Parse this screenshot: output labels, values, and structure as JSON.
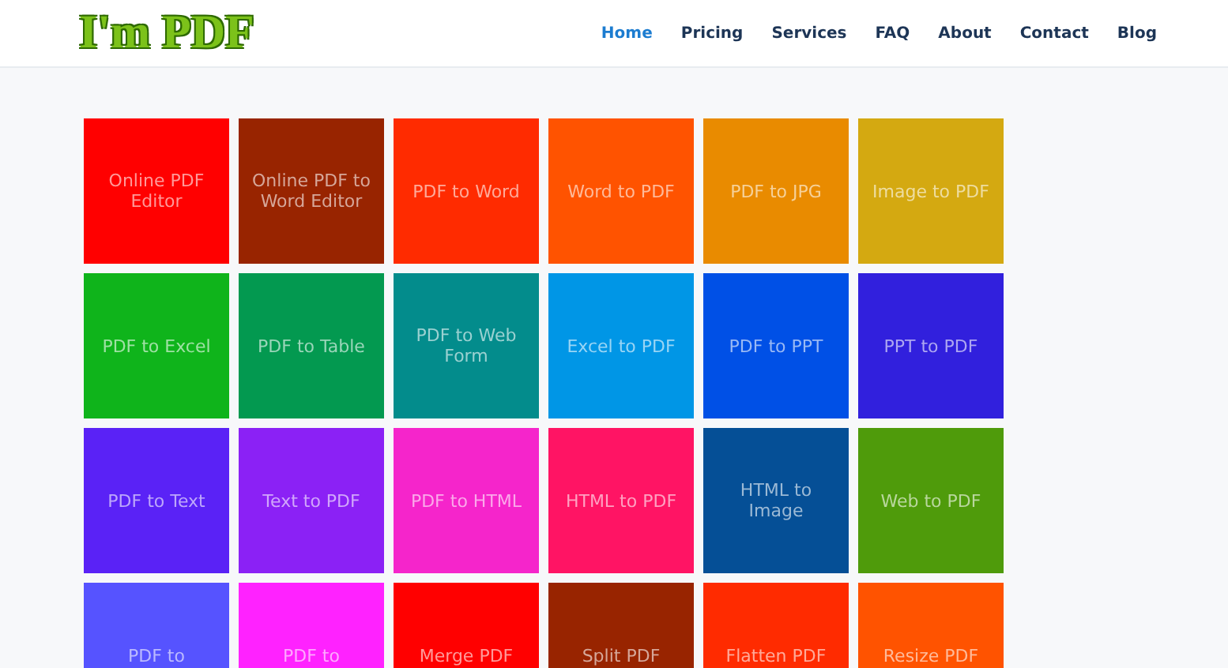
{
  "logo": "I'm PDF",
  "nav": [
    {
      "label": "Home",
      "selected": true
    },
    {
      "label": "Pricing",
      "selected": false
    },
    {
      "label": "Services",
      "selected": false
    },
    {
      "label": "FAQ",
      "selected": false
    },
    {
      "label": "About",
      "selected": false
    },
    {
      "label": "Contact",
      "selected": false
    },
    {
      "label": "Blog",
      "selected": false
    }
  ],
  "tools": [
    {
      "label": "Online PDF Editor",
      "color": "#ff0000"
    },
    {
      "label": "Online PDF to Word Editor",
      "color": "#982400"
    },
    {
      "label": "PDF to Word",
      "color": "#ff2b00"
    },
    {
      "label": "Word to PDF",
      "color": "#ff5300"
    },
    {
      "label": "PDF to JPG",
      "color": "#e98b00"
    },
    {
      "label": "Image to PDF",
      "color": "#d4a911"
    },
    {
      "label": "PDF to Excel",
      "color": "#0fb41b"
    },
    {
      "label": "PDF to Table",
      "color": "#039950"
    },
    {
      "label": "PDF to Web Form",
      "color": "#038c8c"
    },
    {
      "label": "Excel to PDF",
      "color": "#0096e6"
    },
    {
      "label": "PDF to PPT",
      "color": "#0050e6"
    },
    {
      "label": "PPT to PDF",
      "color": "#3120dd"
    },
    {
      "label": "PDF to Text",
      "color": "#5a22f6"
    },
    {
      "label": "Text to PDF",
      "color": "#8b21f5"
    },
    {
      "label": "PDF to HTML",
      "color": "#f525cb"
    },
    {
      "label": "HTML to PDF",
      "color": "#ff1464"
    },
    {
      "label": "HTML to Image",
      "color": "#054f96"
    },
    {
      "label": "Web to PDF",
      "color": "#4f9b0b"
    },
    {
      "label": "PDF to",
      "color": "#5653ff"
    },
    {
      "label": "PDF to",
      "color": "#ff22ff"
    },
    {
      "label": "Merge PDF",
      "color": "#ff0000"
    },
    {
      "label": "Split PDF",
      "color": "#982400"
    },
    {
      "label": "Flatten PDF",
      "color": "#ff2b00"
    },
    {
      "label": "Resize PDF",
      "color": "#ff5300"
    }
  ]
}
